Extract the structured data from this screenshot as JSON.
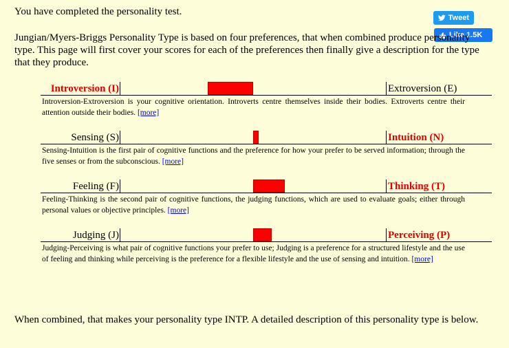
{
  "intro": {
    "completed": "You have completed the personality test.",
    "explanation": "Jungian/Myers-Briggs Personality Type is based on four preferences, that when combined produce personality type. This page will first cover your scores for each of the preferences then finally give a description for the type that they produce."
  },
  "social": {
    "tweet_label": "Tweet",
    "like_label": "Like 1.5K",
    "tweet_color": "#1d9bf0",
    "like_color": "#1877f2"
  },
  "scales": [
    {
      "left_label": "Introversion (I)",
      "right_label": "Extroversion (E)",
      "dominant": "left",
      "fill_from": 0.33,
      "fill_to": 0.5,
      "description": "Introversion-Extroversion is your cognitive orientation. Introverts centre themselves inside their bodies. Extroverts centre their attention outside their bodies.",
      "more_label": "[more]"
    },
    {
      "left_label": "Sensing (S)",
      "right_label": "Intuition (N)",
      "dominant": "right",
      "fill_from": 0.5,
      "fill_to": 0.52,
      "description": "Sensing-Intuition is the first pair of cognitive functions and the preference for how your prefer to be served information; through the five senses or from the subconscious.",
      "more_label": "[more]"
    },
    {
      "left_label": "Feeling (F)",
      "right_label": "Thinking (T)",
      "dominant": "right",
      "fill_from": 0.5,
      "fill_to": 0.62,
      "description": "Feeling-Thinking is the second pair of cognitive functions, the judging functions, which are used to evaluate goals; either through personal values or objective principles.",
      "more_label": "[more]"
    },
    {
      "left_label": "Judging (J)",
      "right_label": "Perceiving (P)",
      "dominant": "right",
      "fill_from": 0.5,
      "fill_to": 0.57,
      "description": "Judging-Perceiving is what pair of cognitive functions your prefer to use; Judging is a preference for a structured lifestyle and the use of feeling and thinking while perceiving is the preference for a flexible lifestyle and the use of sensing and intuition.",
      "more_label": "[more]"
    }
  ],
  "outro": "When combined, that makes your personality type INTP. A detailed description of this personality type is below."
}
